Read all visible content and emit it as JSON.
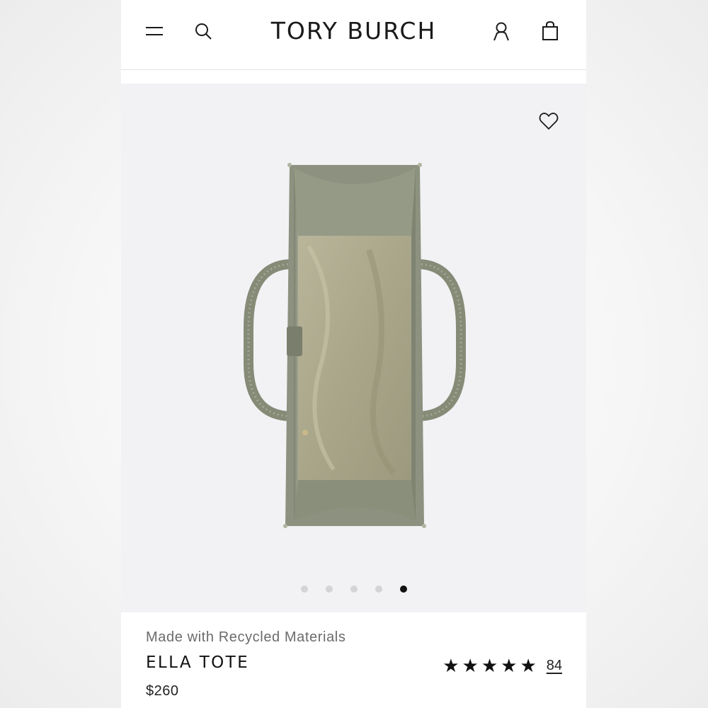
{
  "header": {
    "brand": "TORY BURCH",
    "menu_icon": "hamburger-menu-icon",
    "search_icon": "search-icon",
    "account_icon": "user-icon",
    "bag_icon": "shopping-bag-icon"
  },
  "gallery": {
    "wishlist_icon": "heart-icon",
    "image_subject": "olive green tote bag, top-down interior view",
    "slide_count": 5,
    "active_slide": 5
  },
  "product": {
    "tagline": "Made with Recycled Materials",
    "name": "ELLA TOTE",
    "price": "$260",
    "rating": {
      "stars": "★",
      "star_count": 5,
      "review_count": "84"
    }
  },
  "colors": {
    "background": "#ffffff",
    "hero_background": "#f2f2f4",
    "text": "#111111",
    "muted_text": "#6b6b6b",
    "product_olive": "#8c9180"
  }
}
